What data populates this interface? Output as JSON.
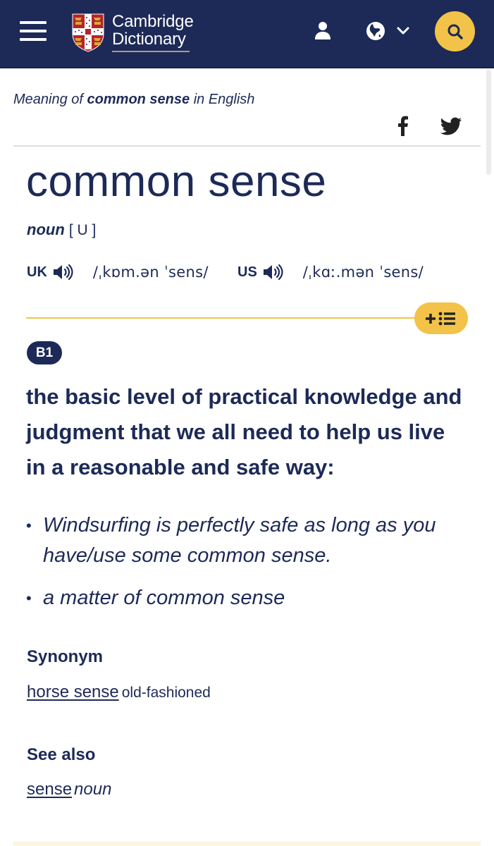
{
  "header": {
    "brand_line1": "Cambridge",
    "brand_line2": "Dictionary",
    "icons": [
      "menu-icon",
      "cambridge-shield-logo",
      "user-icon",
      "globe-icon",
      "chevron-down-icon",
      "search-icon"
    ],
    "colors": {
      "navy": "#1d2a57",
      "accent_yellow": "#f2c348"
    }
  },
  "page": {
    "meaning_prefix": "Meaning of",
    "meaning_term": "common sense",
    "meaning_suffix": "in English",
    "share": [
      "facebook-icon",
      "twitter-icon"
    ]
  },
  "entry": {
    "headword": "common sense",
    "pos": "noun",
    "grammar": "[ U ]",
    "pronunciations": [
      {
        "region": "UK",
        "ipa": "/ˌkɒm.ən ˈsens/"
      },
      {
        "region": "US",
        "ipa": "/ˌkɑː.mən ˈsens/"
      }
    ],
    "add_to_list_icon": "plus-list-icon",
    "level": "B1",
    "definition": "the basic level of practical knowledge and judgment that we all need to help us live in a reasonable and safe way:",
    "examples": [
      "Windsurfing is perfectly safe as long as you have/use some common sense.",
      "a matter of common sense"
    ],
    "synonym": {
      "heading": "Synonym",
      "word": "horse sense",
      "label": "old-fashioned"
    },
    "see_also": {
      "heading": "See also",
      "word": "sense",
      "pos": "noun"
    }
  }
}
